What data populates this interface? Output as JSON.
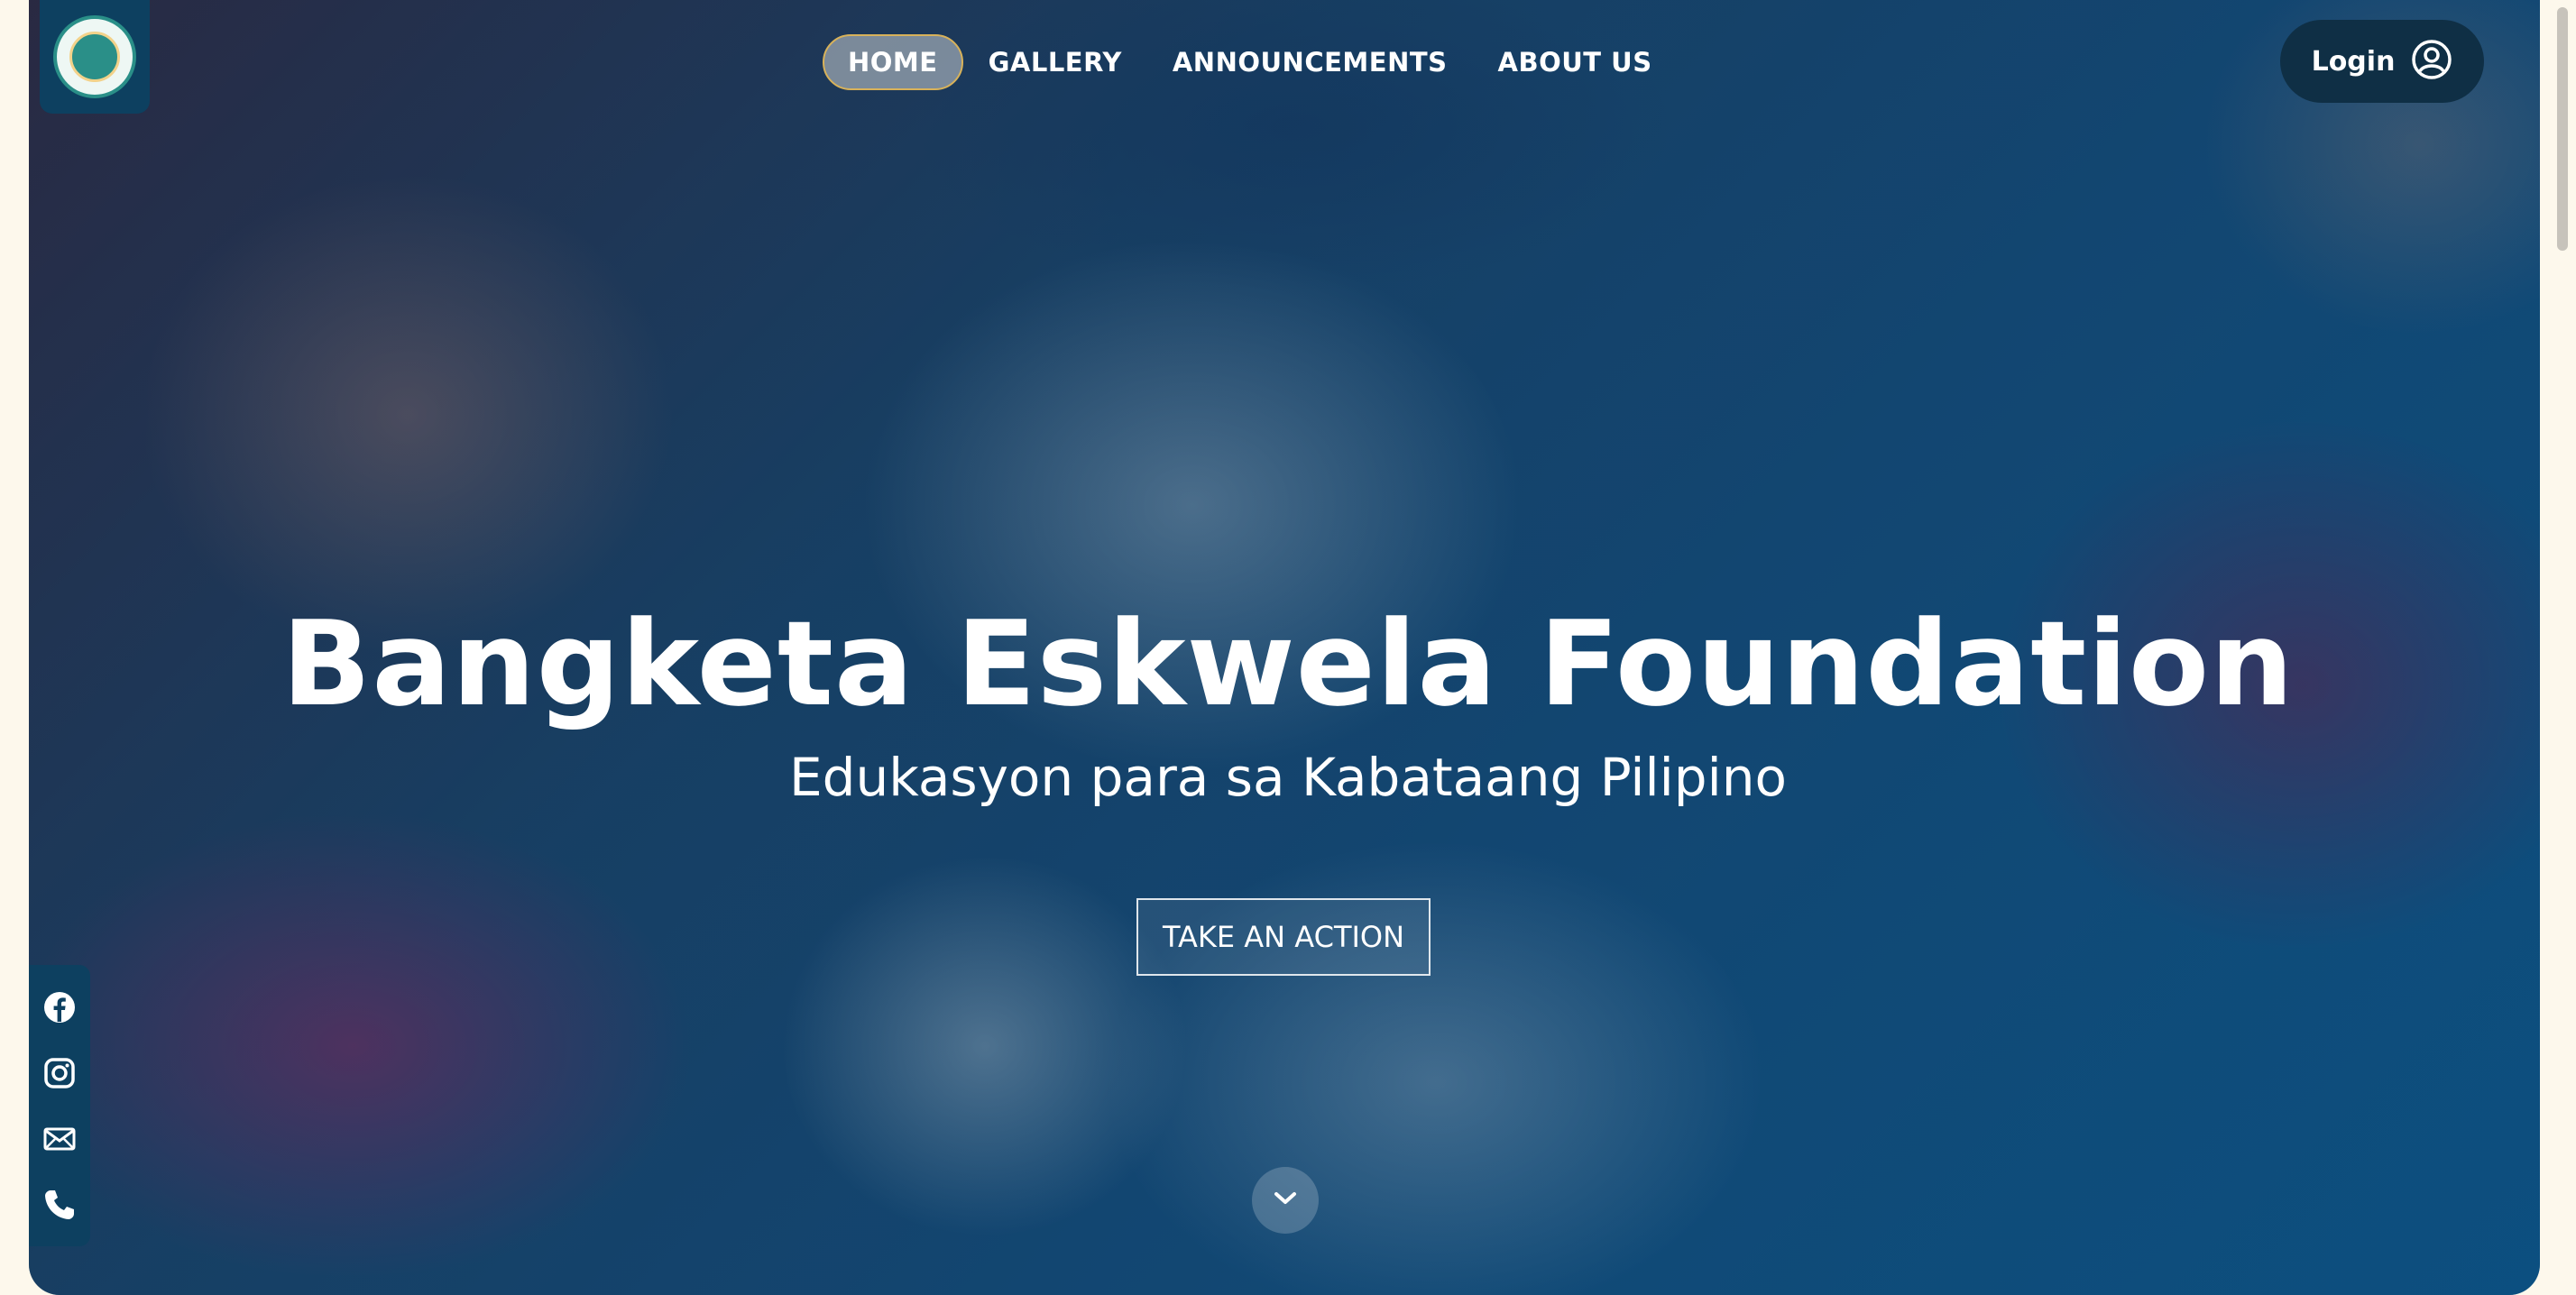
{
  "nav": {
    "items": [
      {
        "label": "HOME",
        "active": true
      },
      {
        "label": "GALLERY",
        "active": false
      },
      {
        "label": "ANNOUNCEMENTS",
        "active": false
      },
      {
        "label": "ABOUT US",
        "active": false
      }
    ]
  },
  "login": {
    "label": "Login",
    "icon": "user-circle-icon"
  },
  "hero": {
    "title": "Bangketa Eskwela Foundation",
    "subtitle": "Edukasyon para sa Kabataang Pilipino",
    "cta_label": "TAKE AN ACTION"
  },
  "social": {
    "icons": [
      "facebook-icon",
      "instagram-icon",
      "email-icon",
      "phone-icon"
    ]
  },
  "colors": {
    "nav_active_border": "#d8b25a",
    "panel": "#0d4060",
    "login_bg": "#0f2f45",
    "overlay_blue": "#0e5786"
  }
}
